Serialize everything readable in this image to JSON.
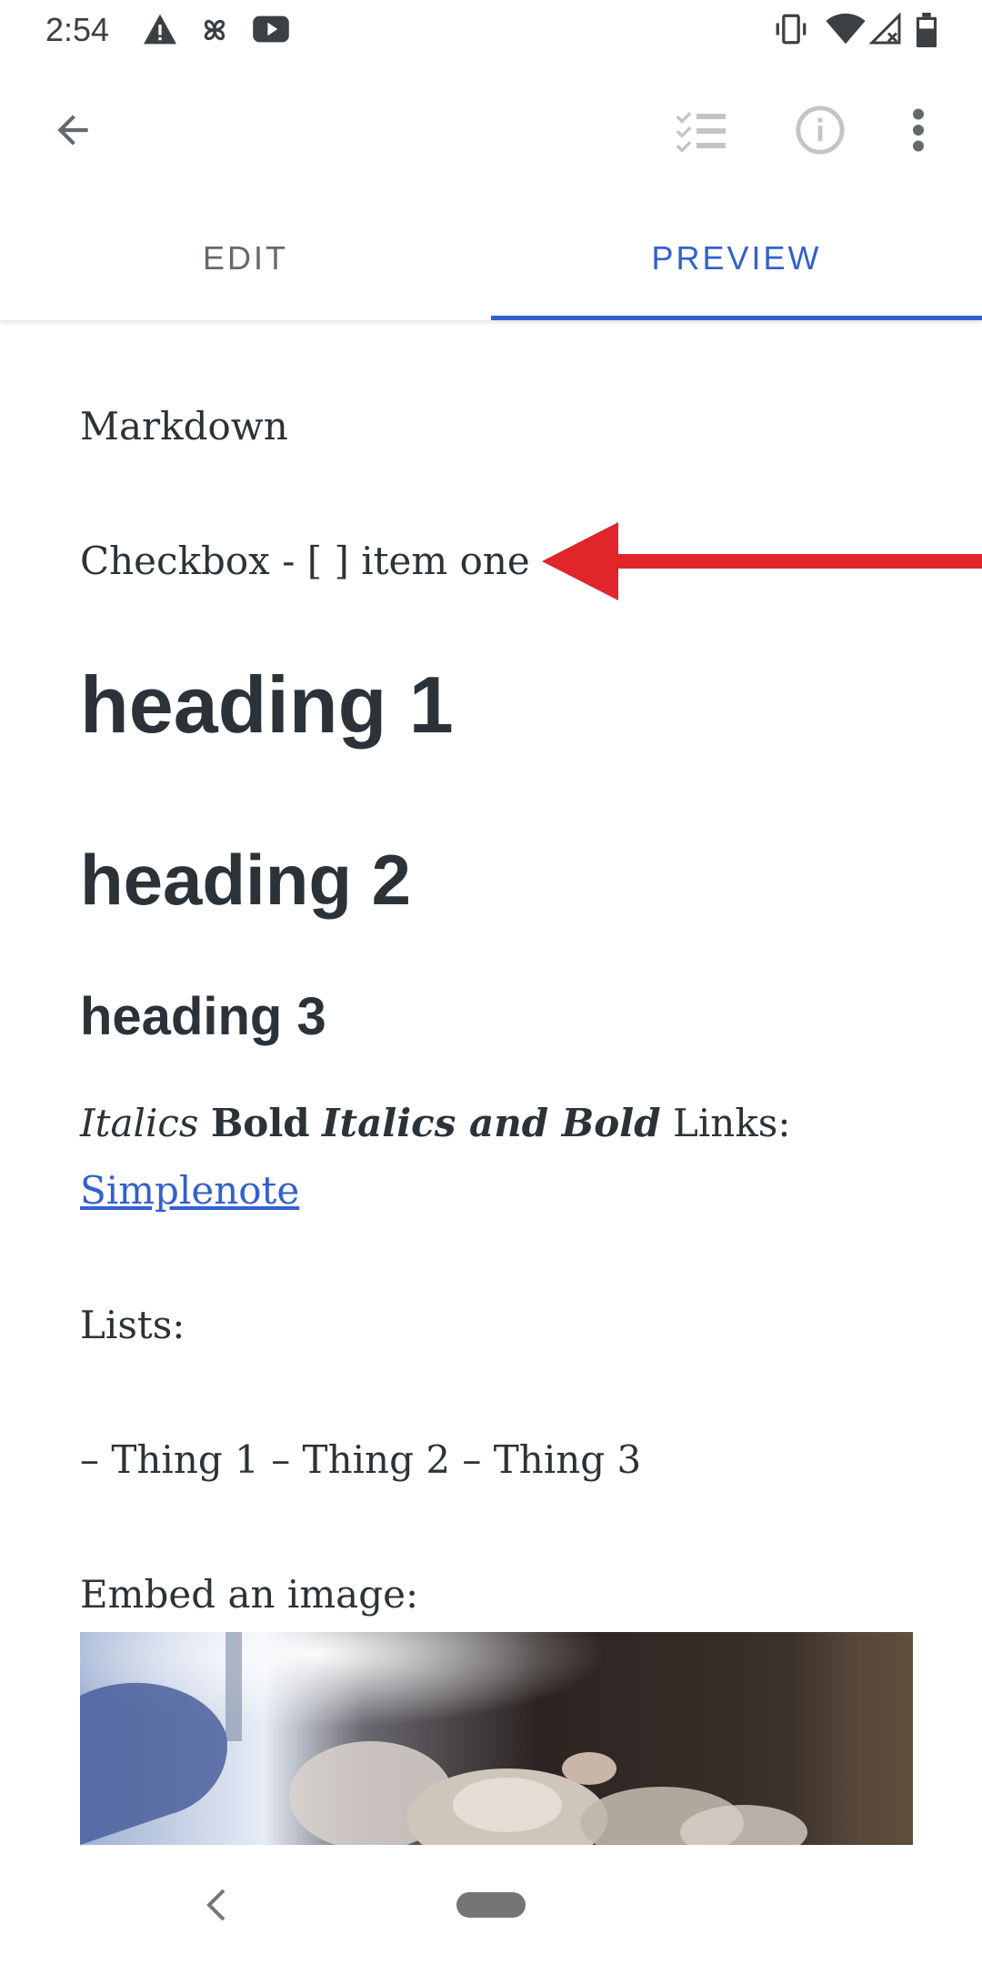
{
  "status_bar": {
    "time": "2:54",
    "left_icons": [
      "warning-icon",
      "pinwheel-icon",
      "youtube-icon"
    ],
    "right_icons": [
      "vibrate-icon",
      "wifi-icon",
      "cell-signal-icon",
      "battery-icon"
    ]
  },
  "app_bar": {
    "back_icon": "arrow-back-icon",
    "actions": [
      "checklist-icon",
      "info-icon",
      "more-vert-icon"
    ]
  },
  "tabs": [
    {
      "label": "EDIT",
      "selected": false
    },
    {
      "label": "PREVIEW",
      "selected": true
    }
  ],
  "preview": {
    "title_line": "Markdown",
    "checkbox_line": "Checkbox - [ ] item one",
    "heading1": "heading 1",
    "heading2": "heading 2",
    "heading3": "heading 3",
    "formatting": {
      "italics": "Italics",
      "bold": "Bold",
      "italics_bold": "Italics and Bold",
      "links_label": "Links:",
      "link_text": "Simplenote"
    },
    "lists_label": "Lists:",
    "list_line": "– Thing 1 – Thing 2 – Thing 3",
    "embed_label": "Embed an image:"
  },
  "colors": {
    "accent": "#3361cc",
    "text": "#2c3338",
    "annotation_arrow": "#e0262b"
  }
}
